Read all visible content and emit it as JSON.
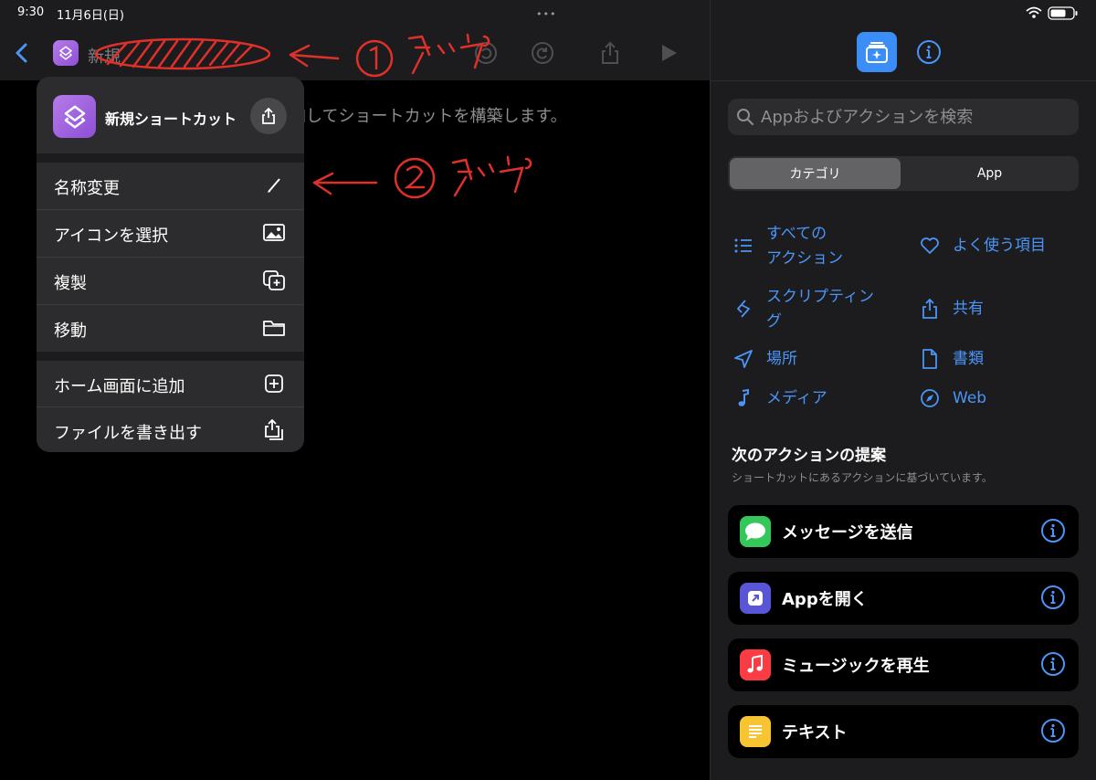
{
  "status": {
    "time": "9:30",
    "date": "11月6日(日)",
    "dots": "•••"
  },
  "editor": {
    "title_fragment": "新規",
    "hint": "加してショートカットを構築します。"
  },
  "annotations": {
    "step1": "①タップ",
    "step2": "②タップ"
  },
  "menu": {
    "title": "新規ショートカット",
    "items": [
      {
        "label": "名称変更",
        "icon": "pencil-icon"
      },
      {
        "label": "アイコンを選択",
        "icon": "photo-icon"
      },
      {
        "label": "複製",
        "icon": "duplicate-icon"
      },
      {
        "label": "移動",
        "icon": "folder-icon"
      },
      {
        "label": "ホーム画面に追加",
        "icon": "plus-square-icon"
      },
      {
        "label": "ファイルを書き出す",
        "icon": "export-icon"
      }
    ]
  },
  "actions_pane": {
    "search_placeholder": "Appおよびアクションを検索",
    "segments": {
      "category": "カテゴリ",
      "app": "App",
      "selected": "カテゴリ"
    },
    "categories": [
      {
        "label_line1": "すべての",
        "label_line2": "アクション",
        "icon": "list-icon"
      },
      {
        "label_line1": "よく使う項目",
        "icon": "heart-icon"
      },
      {
        "label_line1": "スクリプティン",
        "label_line2": "グ",
        "icon": "scripting-icon"
      },
      {
        "label_line1": "共有",
        "icon": "share-icon"
      },
      {
        "label_line1": "場所",
        "icon": "location-icon"
      },
      {
        "label_line1": "書類",
        "icon": "document-icon"
      },
      {
        "label_line1": "メディア",
        "icon": "music-note-icon"
      },
      {
        "label_line1": "Web",
        "icon": "compass-icon"
      }
    ],
    "suggestions_title": "次のアクションの提案",
    "suggestions_subtitle": "ショートカットにあるアクションに基づいています。",
    "suggestions": [
      {
        "label": "メッセージを送信",
        "icon": "messages-icon",
        "color": "#34c759"
      },
      {
        "label": "Appを開く",
        "icon": "open-app-icon",
        "color": "#5856d6"
      },
      {
        "label": "ミュージックを再生",
        "icon": "music-icon",
        "color": "#fc3c44"
      },
      {
        "label": "テキスト",
        "icon": "text-icon",
        "color": "#f7c531"
      }
    ]
  },
  "colors": {
    "accent": "#4a95f7",
    "annotation": "#e0302a",
    "menu_bg": "#2c2c2e",
    "panel_bg": "#1c1c1e"
  }
}
